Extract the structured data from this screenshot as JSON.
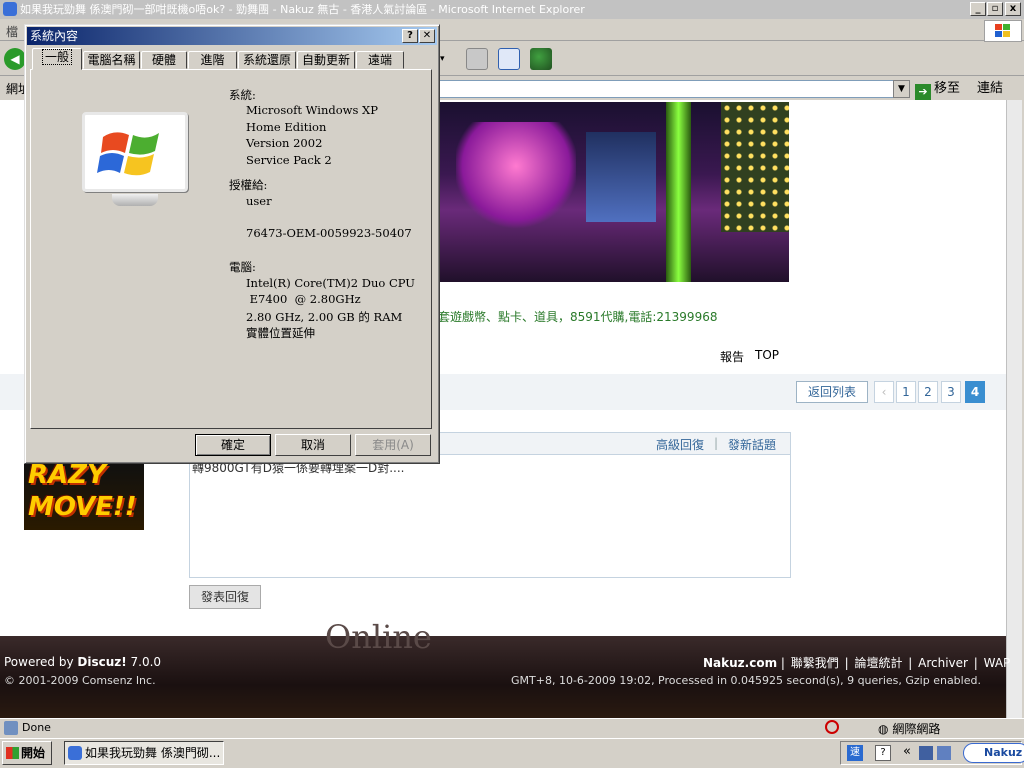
{
  "browser": {
    "title": "如果我玩勁舞 係澳門砌一部咁既機o唔ok? - 勁舞團 - Nakuz 無古 - 香港人氣討論區 - Microsoft Internet Explorer",
    "menu_partial": "檔",
    "address_label": "網址",
    "go_label": "移至",
    "links_label": "連結",
    "status_text": "Done",
    "zone_label": "網際網路"
  },
  "page": {
    "promo_text": "套遊戲幣、點卡、道具，8591代購,電話:21399968",
    "report_label": "報告",
    "top_label": "TOP",
    "back_to_list": "返回列表",
    "pages": [
      "1",
      "2",
      "3",
      "4"
    ],
    "current_page": "4",
    "advanced_reply": "高級回復",
    "separator": "|",
    "new_topic": "發新話題",
    "reply_text": "轉9800GT有D猿一係要轉埋案一D對....",
    "post_reply_button": "發表回復",
    "side_logo_text": [
      "RAZY",
      "MOVE!!"
    ],
    "footer_watermark": "Online",
    "powered_by_prefix": "Powered by ",
    "powered_by_name": "Discuz!",
    "powered_by_version": " 7.0.0",
    "copyright": "© 2001-2009 Comsenz Inc.",
    "footer_links": [
      "Nakuz.com",
      "聯繫我們",
      "論壇統計",
      "Archiver",
      "WAP"
    ],
    "footer_stats": "GMT+8, 10-6-2009 19:02, Processed in 0.045925 second(s), 9 queries, Gzip enabled."
  },
  "dialog": {
    "title": "系統內容",
    "help_button": "?",
    "close_button": "✕",
    "tabs": [
      "一般",
      "電腦名稱",
      "硬體",
      "進階",
      "系統還原",
      "自動更新",
      "遠端"
    ],
    "active_tab": "一般",
    "system_label": "系統:",
    "system_lines": [
      "Microsoft Windows XP",
      "Home Edition",
      "Version 2002",
      "Service Pack 2"
    ],
    "registered_label": "授權給:",
    "registered_user": "user",
    "product_id": "76473-OEM-0059923-50407",
    "computer_label": "電腦:",
    "computer_lines": [
      "Intel(R) Core(TM)2 Duo CPU",
      " E7400  @ 2.80GHz",
      "2.80 GHz, 2.00 GB 的 RAM",
      "實體位置延伸"
    ],
    "ok_button": "確定",
    "cancel_button": "取消",
    "apply_button": "套用(A)"
  },
  "taskbar": {
    "start_label": "開始",
    "task_item": "如果我玩勁舞 係澳門砌...",
    "tray_badge": "Nakuz"
  },
  "colors": {
    "dialog_title_start": "#0a246a",
    "dialog_title_end": "#a6caf0",
    "link": "#336699",
    "promo": "#2a7a2a",
    "current_page": "#3a8ed0"
  }
}
